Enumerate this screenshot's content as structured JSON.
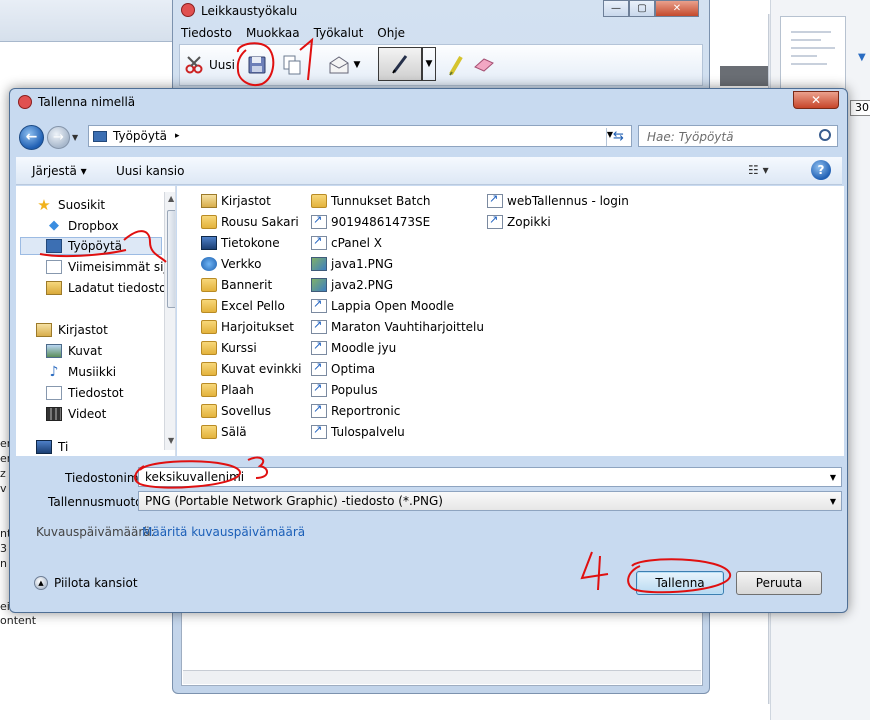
{
  "background": {
    "left_fragments": [
      "er",
      "er",
      "z",
      "v",
      "nt",
      "3",
      "n",
      "ei",
      "ontent"
    ],
    "right_field": "30"
  },
  "snipping_tool": {
    "title": "Leikkaustyökalu",
    "menus": [
      "Tiedosto",
      "Muokkaa",
      "Työkalut",
      "Ohje"
    ],
    "new_label": "Uusi",
    "window_controls": {
      "min": "—",
      "max": "▢",
      "close": "✕"
    }
  },
  "dialog": {
    "title": "Tallenna nimellä",
    "close": "✕",
    "address": {
      "crumb": "Työpöytä",
      "sep": "▸"
    },
    "search_placeholder": "Hae: Työpöytä",
    "commands": {
      "organize": "Järjestä ▾",
      "new_folder": "Uusi kansio",
      "view": "☷ ▾",
      "help": "?"
    },
    "nav": {
      "favorites": "Suosikit",
      "dropbox": "Dropbox",
      "desktop": "Työpöytä",
      "recent": "Viimeisimmät sija",
      "downloads": "Ladatut tiedostot",
      "libraries": "Kirjastot",
      "pictures": "Kuvat",
      "music": "Musiikki",
      "documents": "Tiedostot",
      "videos": "Videot",
      "partial": "Ti"
    },
    "files": {
      "col1": [
        {
          "name": "Kirjastot",
          "icon": "lib"
        },
        {
          "name": "Rousu Sakari",
          "icon": "folder"
        },
        {
          "name": "Tietokone",
          "icon": "pc"
        },
        {
          "name": "Verkko",
          "icon": "net"
        },
        {
          "name": "Bannerit",
          "icon": "folder"
        },
        {
          "name": "Excel Pello",
          "icon": "folder"
        },
        {
          "name": "Harjoitukset",
          "icon": "folder"
        },
        {
          "name": "Kurssi",
          "icon": "folder"
        },
        {
          "name": "Kuvat evinkki",
          "icon": "folder"
        },
        {
          "name": "Plaah",
          "icon": "folder"
        },
        {
          "name": "Sovellus",
          "icon": "folder"
        },
        {
          "name": "Sälä",
          "icon": "folder"
        }
      ],
      "col2": [
        {
          "name": "Tunnukset Batch",
          "icon": "folder"
        },
        {
          "name": "90194861473SE",
          "icon": "shortcut"
        },
        {
          "name": "cPanel X",
          "icon": "shortcut"
        },
        {
          "name": "java1.PNG",
          "icon": "img"
        },
        {
          "name": "java2.PNG",
          "icon": "img"
        },
        {
          "name": "Lappia Open Moodle",
          "icon": "shortcut"
        },
        {
          "name": "Maraton Vauhtiharjoittelu",
          "icon": "shortcut"
        },
        {
          "name": "Moodle jyu",
          "icon": "shortcut"
        },
        {
          "name": "Optima",
          "icon": "shortcut"
        },
        {
          "name": "Populus",
          "icon": "shortcut"
        },
        {
          "name": "Reportronic",
          "icon": "shortcut"
        },
        {
          "name": "Tulospalvelu",
          "icon": "shortcut"
        }
      ],
      "col3": [
        {
          "name": "webTallennus - login",
          "icon": "shortcut"
        },
        {
          "name": "Zopikki",
          "icon": "shortcut"
        }
      ]
    },
    "filename_label": "Tiedostonimi:",
    "filename_value": "keksikuvallenimi",
    "filetype_label": "Tallennusmuoto:",
    "filetype_value": "PNG (Portable Network Graphic) -tiedosto (*.PNG)",
    "date_label": "Kuvauspäivämäärä:",
    "date_link": "Määritä kuvauspäivämäärä",
    "hide_folders": "Piilota kansiot",
    "save": "Tallenna",
    "cancel": "Peruuta"
  },
  "annotations": {
    "step1": "1",
    "step3": "3",
    "step4": "4",
    "color": "#e01010"
  }
}
